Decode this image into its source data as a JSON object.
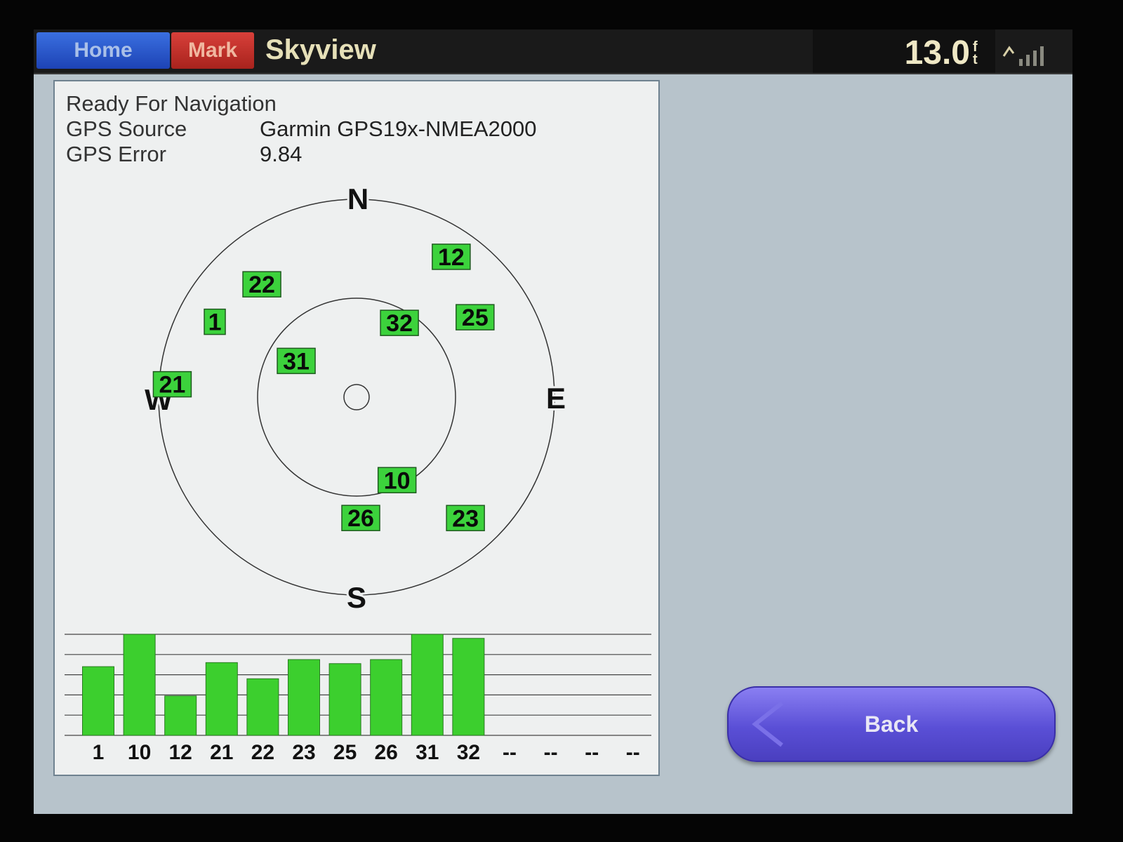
{
  "topbar": {
    "home_label": "Home",
    "mark_label": "Mark",
    "title": "Skyview",
    "depth_value": "13.0",
    "depth_unit_top": "f",
    "depth_unit_bottom": "t",
    "signal_icon": "gps-signal-icon"
  },
  "info": {
    "status": "Ready For Navigation",
    "source_label": "GPS Source",
    "source_value": "Garmin GPS19x-NMEA2000",
    "error_label": "GPS Error",
    "error_value": "9.84"
  },
  "skyview": {
    "compass": {
      "north": "N",
      "east": "E",
      "south": "S",
      "west": "W"
    },
    "satellites": [
      {
        "id": "12",
        "azimuth_deg": 34,
        "elevation_deg": 13
      },
      {
        "id": "22",
        "azimuth_deg": 320,
        "elevation_deg": 23
      },
      {
        "id": "1",
        "azimuth_deg": 298,
        "elevation_deg": 17
      },
      {
        "id": "32",
        "azimuth_deg": 30,
        "elevation_deg": 51
      },
      {
        "id": "25",
        "azimuth_deg": 56,
        "elevation_deg": 25
      },
      {
        "id": "31",
        "azimuth_deg": 301,
        "elevation_deg": 58
      },
      {
        "id": "21",
        "azimuth_deg": 274,
        "elevation_deg": 6
      },
      {
        "id": "10",
        "azimuth_deg": 154,
        "elevation_deg": 48
      },
      {
        "id": "26",
        "azimuth_deg": 178,
        "elevation_deg": 35
      },
      {
        "id": "23",
        "azimuth_deg": 138,
        "elevation_deg": 16
      }
    ]
  },
  "signal_bars": {
    "bars": [
      {
        "label": "1",
        "level": 0.68
      },
      {
        "label": "10",
        "level": 1.0
      },
      {
        "label": "12",
        "level": 0.39
      },
      {
        "label": "21",
        "level": 0.72
      },
      {
        "label": "22",
        "level": 0.56
      },
      {
        "label": "23",
        "level": 0.75
      },
      {
        "label": "25",
        "level": 0.71
      },
      {
        "label": "26",
        "level": 0.75
      },
      {
        "label": "31",
        "level": 1.0
      },
      {
        "label": "32",
        "level": 0.96
      }
    ],
    "empty_labels": [
      "--",
      "--",
      "--",
      "--"
    ]
  },
  "back_button": {
    "label": "Back"
  },
  "colors": {
    "satellite_green": "#3cd23c",
    "bar_green": "#3ccf2e",
    "home_blue": "#2a55d0",
    "mark_red": "#c22f28",
    "back_purple": "#5a4fd6"
  }
}
